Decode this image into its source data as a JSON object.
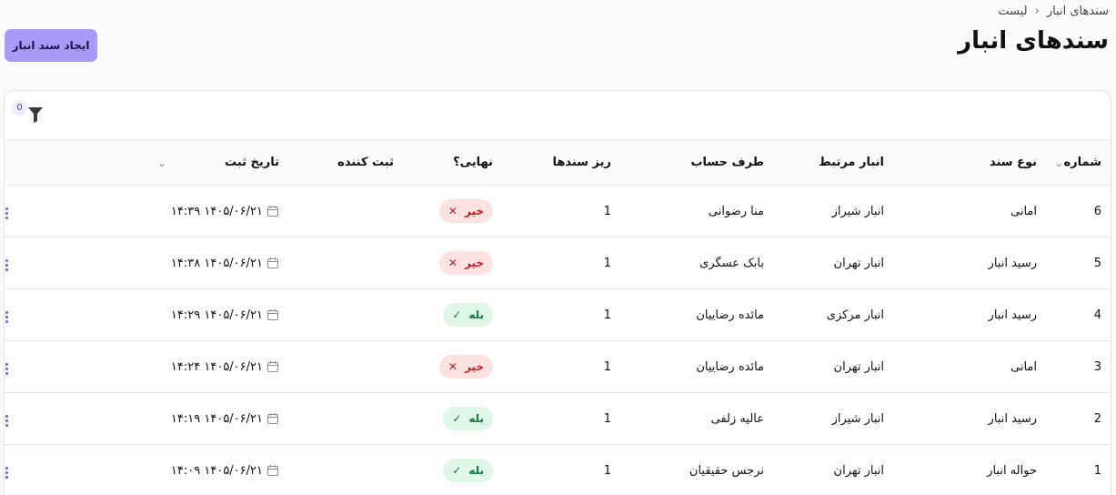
{
  "breadcrumb": {
    "root": "سندهای انبار",
    "separator": "›",
    "current": "لیست"
  },
  "page_title": "سندهای انبار",
  "create_button": "ایجاد سند انبار",
  "filter": {
    "count": "0",
    "icon": "filter-icon"
  },
  "columns": {
    "number": "شماره",
    "doc_type": "نوع سند",
    "warehouse": "انبار مرتبط",
    "party": "طرف حساب",
    "items": "ریز سندها",
    "final": "نهایی؟",
    "creator": "ثبت کننده",
    "date": "تاریخ ثبت"
  },
  "rows": [
    {
      "number": "6",
      "doc_type": "امانی",
      "warehouse": "انبار شیراز",
      "party": "منا رضوانی",
      "items": "1",
      "final": "خیر",
      "final_state": "no",
      "creator": "",
      "date": "۱۴۰۵/۰۶/۲۱ ۱۴:۳۹"
    },
    {
      "number": "5",
      "doc_type": "رسید انبار",
      "warehouse": "انبار تهران",
      "party": "بابک عسگری",
      "items": "1",
      "final": "خیر",
      "final_state": "no",
      "creator": "",
      "date": "۱۴۰۵/۰۶/۲۱ ۱۴:۳۸"
    },
    {
      "number": "4",
      "doc_type": "رسید انبار",
      "warehouse": "انبار مرکزی",
      "party": "مائده رضاییان",
      "items": "1",
      "final": "بله",
      "final_state": "yes",
      "creator": "",
      "date": "۱۴۰۵/۰۶/۲۱ ۱۴:۲۹"
    },
    {
      "number": "3",
      "doc_type": "امانی",
      "warehouse": "انبار تهران",
      "party": "مائده رضاییان",
      "items": "1",
      "final": "خیر",
      "final_state": "no",
      "creator": "",
      "date": "۱۴۰۵/۰۶/۲۱ ۱۴:۲۴"
    },
    {
      "number": "2",
      "doc_type": "رسید انبار",
      "warehouse": "انبار شیراز",
      "party": "عالیه زلفی",
      "items": "1",
      "final": "بله",
      "final_state": "yes",
      "creator": "",
      "date": "۱۴۰۵/۰۶/۲۱ ۱۴:۱۹"
    },
    {
      "number": "1",
      "doc_type": "حواله انبار",
      "warehouse": "انبار تهران",
      "party": "نرجس حقیقیان",
      "items": "1",
      "final": "بله",
      "final_state": "yes",
      "creator": "",
      "date": "۱۴۰۵/۰۶/۲۱ ۱۴:۰۹"
    }
  ],
  "colors": {
    "accent": "#a99af7",
    "no_bg": "#fde2e2",
    "no_fg": "#c81e1e",
    "yes_bg": "#def7e6",
    "yes_fg": "#157a3a"
  }
}
